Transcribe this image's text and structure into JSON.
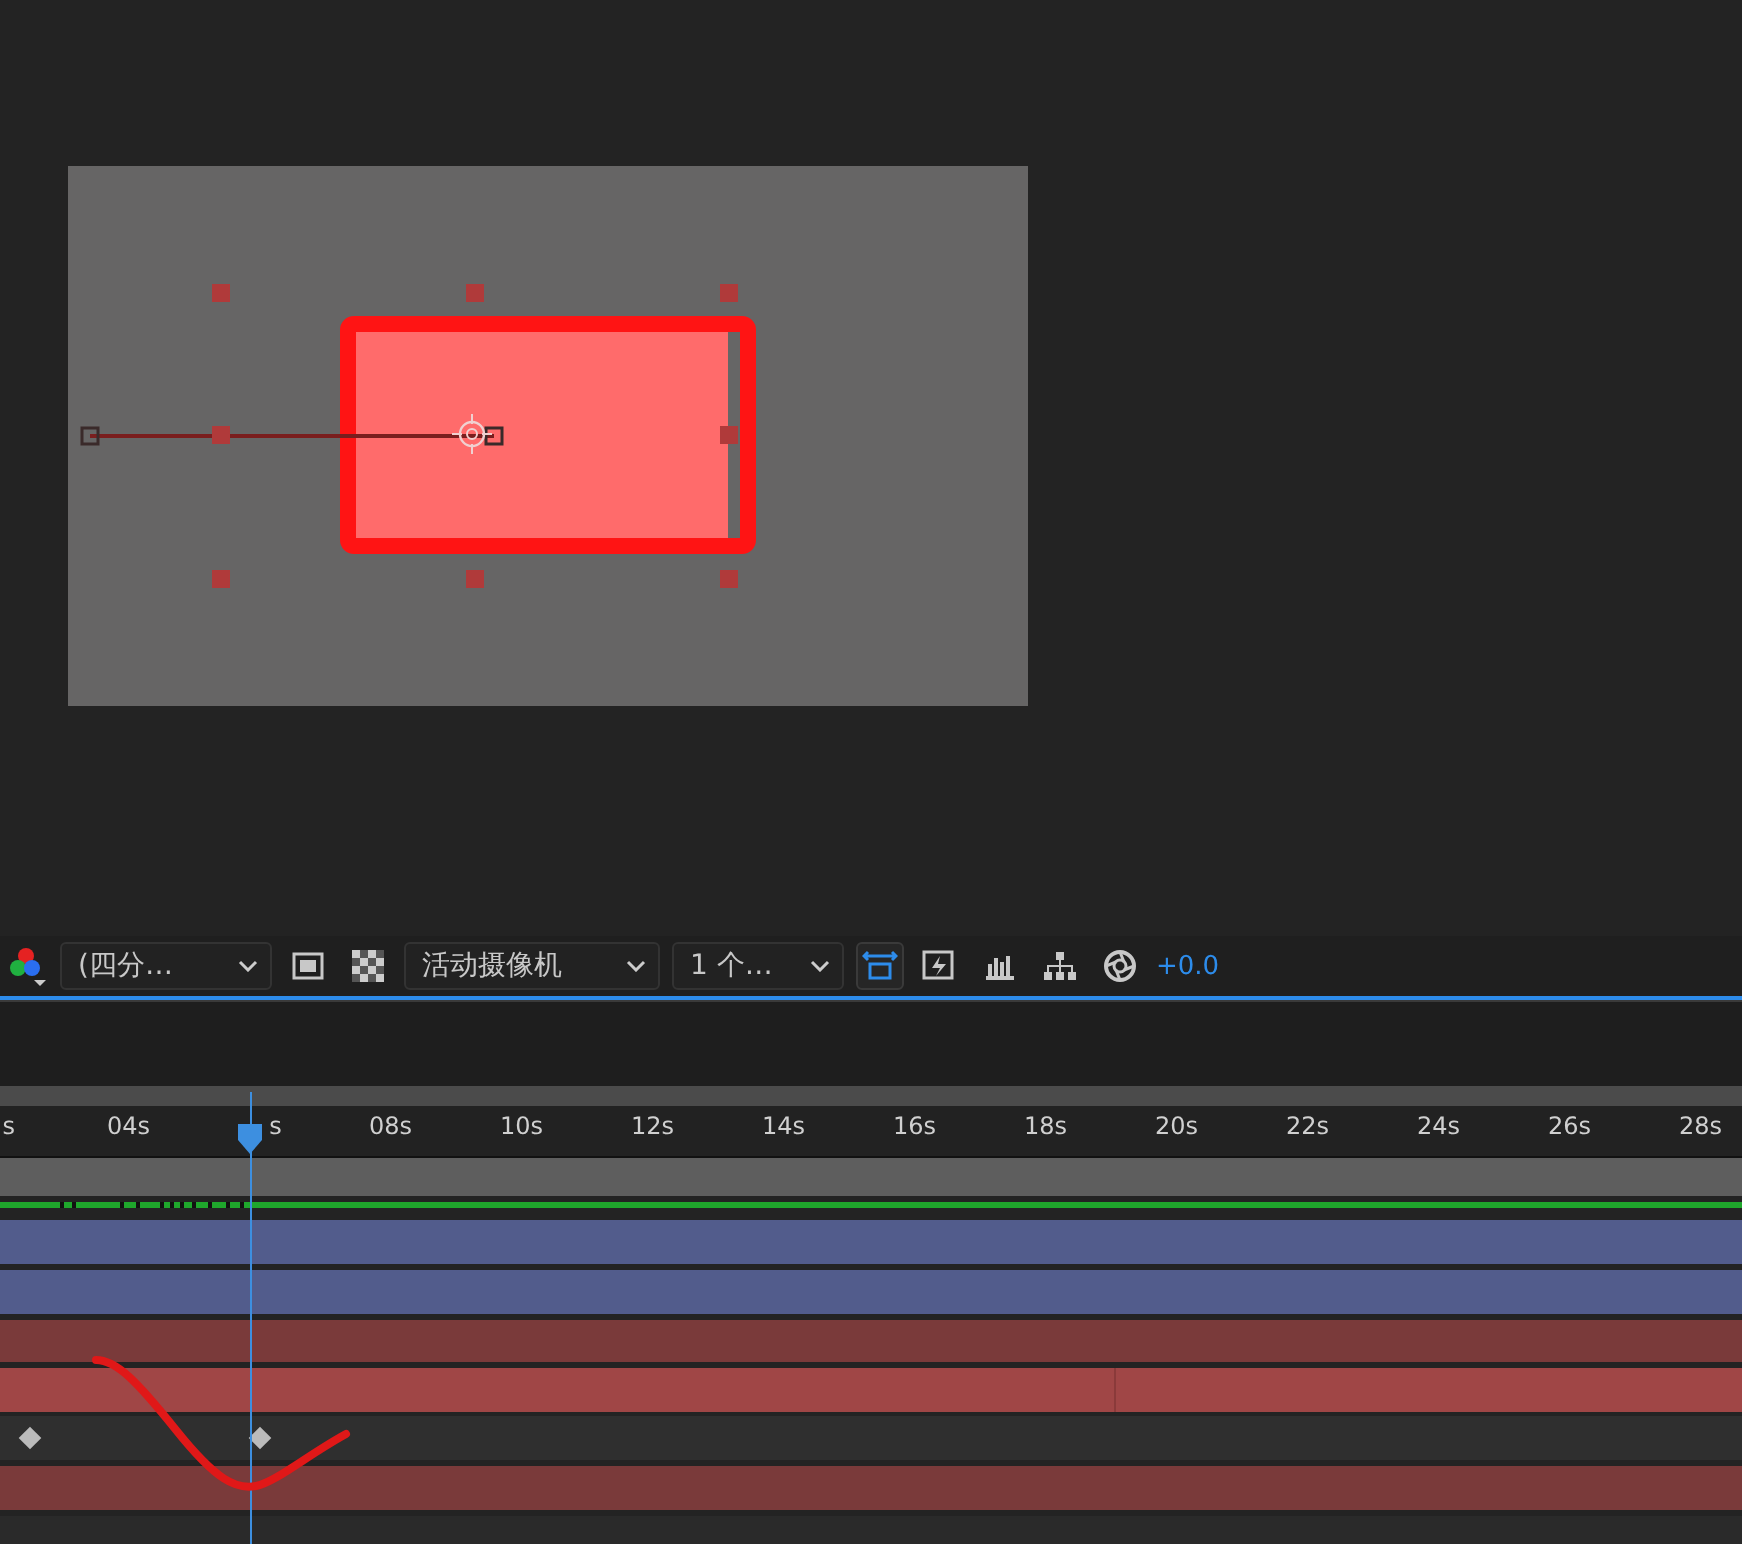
{
  "toolbar": {
    "items": [
      {
        "kind": "channels"
      },
      {
        "kind": "dropdown",
        "label": "(四分…"
      },
      {
        "kind": "region",
        "selected": false
      },
      {
        "kind": "checker",
        "selected": false
      },
      {
        "kind": "dropdown",
        "label": "活动摄像机"
      },
      {
        "kind": "dropdown",
        "label": "1 个…"
      },
      {
        "kind": "frame",
        "selected": true
      },
      {
        "kind": "lightning",
        "selected": false
      },
      {
        "kind": "chart",
        "selected": false
      },
      {
        "kind": "tree",
        "selected": false
      },
      {
        "kind": "aperture",
        "selected": false
      },
      {
        "kind": "reading",
        "label": "+0.0"
      }
    ]
  },
  "timeline": {
    "ruler": [
      "s",
      "04s",
      "s",
      "08s",
      "10s",
      "12s",
      "14s",
      "16s",
      "18s",
      "20s",
      "22s",
      "24s",
      "26s",
      "28s"
    ],
    "playhead": {
      "level": 0.144
    },
    "tracks": [
      {
        "kind": "audio",
        "color": "#1fa62c"
      },
      {
        "kind": "bar",
        "color": "#525c8c"
      },
      {
        "kind": "bar",
        "color": "#525c8c"
      },
      {
        "kind": "bar",
        "color": "#7a3a3a"
      },
      {
        "kind": "textured",
        "color": "#a04646"
      },
      {
        "kind": "keys",
        "keyframes": [
          {
            "level": 0.017
          },
          {
            "level": 0.149
          }
        ]
      },
      {
        "kind": "bar",
        "color": "#7a3a3a"
      },
      {
        "kind": "empty"
      }
    ]
  }
}
